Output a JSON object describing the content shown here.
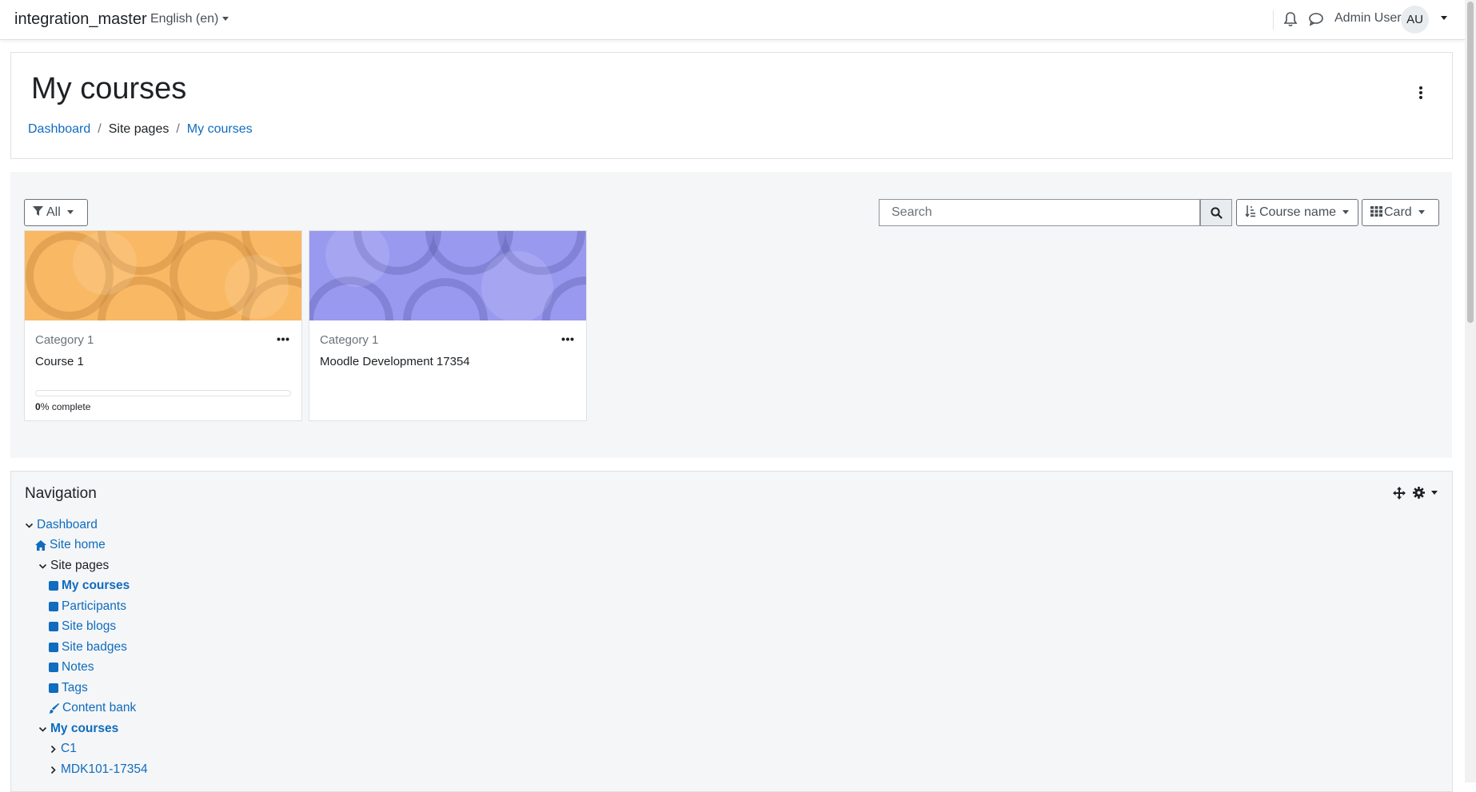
{
  "navbar": {
    "site_name": "integration_master",
    "language": "English (en)",
    "user_name": "Admin User",
    "avatar_initials": "AU"
  },
  "header": {
    "title": "My courses",
    "breadcrumb": [
      "Dashboard",
      "Site pages",
      "My courses"
    ]
  },
  "overview": {
    "filter_label": "All",
    "search_placeholder": "Search",
    "sort_label": "Course name",
    "view_label": "Card",
    "courses": [
      {
        "category": "Category 1",
        "name": "Course 1",
        "progress": 0,
        "progress_suffix": "% complete",
        "image_color": "#f9b864"
      },
      {
        "category": "Category 1",
        "name": "Moodle Development 17354",
        "progress": null,
        "image_color": "#9999f0"
      }
    ]
  },
  "navigation": {
    "title": "Navigation",
    "items": [
      {
        "label": "Dashboard",
        "icon": "chevron-down-icon"
      },
      {
        "label": "Site home",
        "icon": "home-icon"
      },
      {
        "label": "Site pages",
        "icon": "chevron-down-icon"
      },
      {
        "label": "My courses",
        "icon": "page-icon"
      },
      {
        "label": "Participants",
        "icon": "page-icon"
      },
      {
        "label": "Site blogs",
        "icon": "page-icon"
      },
      {
        "label": "Site badges",
        "icon": "page-icon"
      },
      {
        "label": "Notes",
        "icon": "page-icon"
      },
      {
        "label": "Tags",
        "icon": "page-icon"
      },
      {
        "label": "Content bank",
        "icon": "paintbrush-icon"
      },
      {
        "label": "My courses",
        "icon": "chevron-down-icon"
      },
      {
        "label": "C1",
        "icon": "chevron-right-icon"
      },
      {
        "label": "MDK101-17354",
        "icon": "chevron-right-icon"
      }
    ]
  },
  "colors": {
    "link": "#0f6cbf",
    "text": "#1d2125",
    "muted": "#6a737b"
  }
}
